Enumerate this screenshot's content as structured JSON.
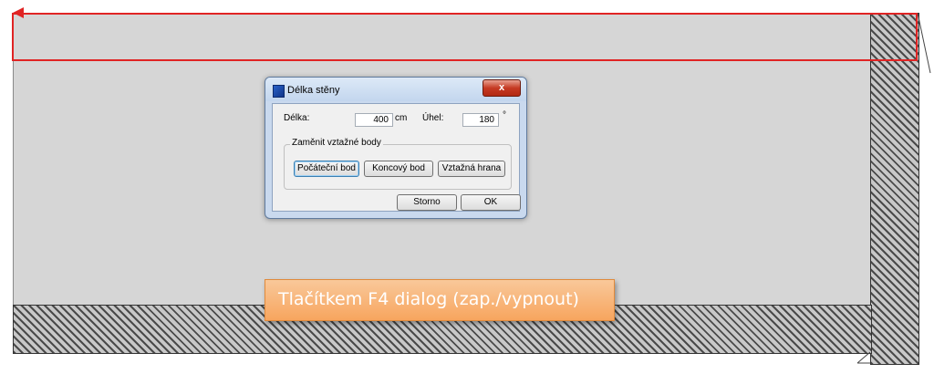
{
  "dialog": {
    "title": "Délka stěny",
    "close_label": "x",
    "length_label": "Délka:",
    "length_value": "400",
    "length_unit": "cm",
    "angle_label": "Úhel:",
    "angle_value": "180",
    "angle_unit": "°",
    "group_title": "Zaměnit vztažné body",
    "buttons": {
      "start_point": "Počáteční bod",
      "end_point": "Koncový bod",
      "reference_edge": "Vztažná hrana",
      "cancel": "Storno",
      "ok": "OK"
    }
  },
  "callout": {
    "text": "Tlačítkem F4 dialog (zap./vypnout)"
  },
  "colors": {
    "selection": "#e02424",
    "callout_bg": "#f7a55e",
    "canvas_bg": "#d6d6d6"
  }
}
